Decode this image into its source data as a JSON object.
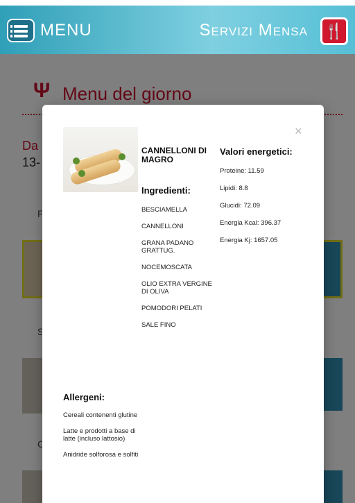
{
  "header": {
    "menu_label": "MENU",
    "service_title": "Servizi Mensa",
    "menu_icon": "hamburger-menu-icon",
    "service_icon": "fork-knife-icon",
    "colors": {
      "header_bg": "#2f9fb8",
      "accent": "#c8102e"
    }
  },
  "page": {
    "title": "Menu del giorno",
    "title_icon": "fork-knife-icon",
    "date_label": "Da",
    "date_value": "13-",
    "bg_letters": [
      "P",
      "S",
      "C"
    ]
  },
  "modal": {
    "close_label": "×",
    "dish_name": "CANNELLONI DI MAGRO",
    "ingredients_title": "Ingredienti:",
    "ingredients": [
      "BESCIAMELLA",
      "CANNELLONI",
      "GRANA PADANO GRATTUG.",
      "NOCEMOSCATA",
      "OLIO EXTRA VERGINE DI OLIVA",
      "POMODORI PELATI",
      "SALE FINO"
    ],
    "values_title": "Valori energetici:",
    "values": [
      "Proteine: 11.59",
      "Lipidi: 8.8",
      "Glucidi: 72.09",
      "Energia Kcal: 396.37",
      "Energia Kj: 1657.05"
    ],
    "allergens_title": "Allergeni:",
    "allergens": [
      "Cereali contenenti glutine",
      "Latte e prodotti a base di latte (incluso lattosio)",
      "Anidride solforosa e solfiti"
    ]
  }
}
